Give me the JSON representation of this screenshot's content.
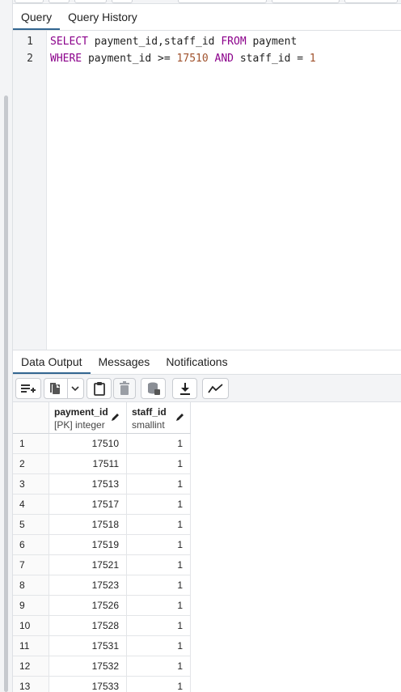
{
  "query_tabs": [
    {
      "label": "Query",
      "active": true
    },
    {
      "label": "Query History",
      "active": false
    }
  ],
  "editor": {
    "lines": [
      {
        "no": "1",
        "tokens": [
          {
            "t": "SELECT",
            "k": "kw"
          },
          {
            "t": " payment_id,staff_id ",
            "k": ""
          },
          {
            "t": "FROM",
            "k": "kw"
          },
          {
            "t": " payment",
            "k": ""
          }
        ]
      },
      {
        "no": "2",
        "tokens": [
          {
            "t": "WHERE",
            "k": "kw"
          },
          {
            "t": " payment_id >= ",
            "k": ""
          },
          {
            "t": "17510",
            "k": "num"
          },
          {
            "t": " ",
            "k": ""
          },
          {
            "t": "AND",
            "k": "kw"
          },
          {
            "t": " staff_id = ",
            "k": ""
          },
          {
            "t": "1",
            "k": "num"
          }
        ]
      }
    ]
  },
  "output_tabs": [
    {
      "label": "Data Output",
      "active": true
    },
    {
      "label": "Messages",
      "active": false
    },
    {
      "label": "Notifications",
      "active": false
    }
  ],
  "toolbar_icons": [
    "add-row-icon",
    "copy-icon",
    "chevron-down-icon",
    "paste-icon",
    "delete-icon",
    "save-data-icon",
    "download-icon",
    "graph-icon"
  ],
  "grid": {
    "columns": [
      {
        "name": "payment_id",
        "type": "[PK] integer"
      },
      {
        "name": "staff_id",
        "type": "smallint"
      }
    ],
    "rows": [
      [
        "1",
        "17510",
        "1"
      ],
      [
        "2",
        "17511",
        "1"
      ],
      [
        "3",
        "17513",
        "1"
      ],
      [
        "4",
        "17517",
        "1"
      ],
      [
        "5",
        "17518",
        "1"
      ],
      [
        "6",
        "17519",
        "1"
      ],
      [
        "7",
        "17521",
        "1"
      ],
      [
        "8",
        "17523",
        "1"
      ],
      [
        "9",
        "17526",
        "1"
      ],
      [
        "10",
        "17528",
        "1"
      ],
      [
        "11",
        "17531",
        "1"
      ],
      [
        "12",
        "17532",
        "1"
      ],
      [
        "13",
        "17533",
        "1"
      ]
    ]
  },
  "colors": {
    "accent": "#326690",
    "keyword": "#8b008b",
    "number": "#a0522d"
  }
}
